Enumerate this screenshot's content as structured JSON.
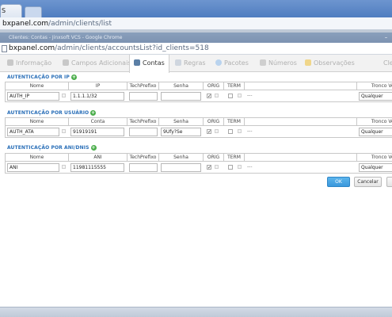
{
  "browser": {
    "tab_label": "S",
    "outer_url_domain": "bxpanel.com",
    "outer_url_path": "/admin/clients/list",
    "popup_title": "Clientes: Contas - Jinxsoft VCS - Google Chrome",
    "popup_url_domain": "bxpanel.com",
    "popup_url_path": "/admin/clients/accountsList?id_clients=518"
  },
  "tabs": [
    {
      "label": "Informação",
      "icon": "person-icon"
    },
    {
      "label": "Campos Adicionais",
      "icon": "list-icon"
    },
    {
      "label": "Contas",
      "icon": "accounts-icon",
      "active": true
    },
    {
      "label": "Regras",
      "icon": "rules-icon"
    },
    {
      "label": "Pacotes",
      "icon": "package-icon"
    },
    {
      "label": "Números",
      "icon": "numbers-icon"
    },
    {
      "label": "Observações",
      "icon": "notes-icon"
    },
    {
      "label": "Cle",
      "icon": ""
    }
  ],
  "sections": [
    {
      "title": "AUTENTICAÇÃO POR IP",
      "headers": {
        "nome": "Nome",
        "col2": "IP",
        "tech": "TechPrefixo",
        "senha": "Senha",
        "orig": "ORIG",
        "term": "TERM",
        "tronco": "Tronco VoIP"
      },
      "row": {
        "nome": "AUTH_IP",
        "col2": "1.1.1.1/32",
        "tech": "",
        "senha": "",
        "orig_checked": "✓",
        "term_checked": "",
        "dash": "---",
        "tronco": "Qualquer"
      }
    },
    {
      "title": "AUTENTICAÇÃO POR USUÁRIO",
      "headers": {
        "nome": "Nome",
        "col2": "Conta",
        "tech": "TechPrefixo",
        "senha": "Senha",
        "orig": "ORIG",
        "term": "TERM",
        "tronco": "Tronco VoIP"
      },
      "row": {
        "nome": "AUTH_ATA",
        "col2": "91919191",
        "tech": "",
        "senha": "9Ufy?Se",
        "orig_checked": "✓",
        "term_checked": "",
        "dash": "---",
        "tronco": "Qualquer"
      }
    },
    {
      "title": "AUTENTICAÇÃO POR ANI/DNIS",
      "headers": {
        "nome": "Nome",
        "col2": "ANI",
        "tech": "TechPrefixo",
        "senha": "Senha",
        "orig": "ORIG",
        "term": "TERM",
        "tronco": "Tronco VoIP"
      },
      "row": {
        "nome": "ANI",
        "col2": "11981115555",
        "tech": "",
        "senha": "",
        "orig_checked": "✓",
        "term_checked": "",
        "dash": "---",
        "tronco": "Qualquer"
      }
    }
  ],
  "buttons": {
    "ok": "OK",
    "cancel": "Cancelar"
  },
  "colors": {
    "accent": "#3a98dc",
    "section_title": "#2a6fb8",
    "add_icon": "#4cae4c"
  }
}
